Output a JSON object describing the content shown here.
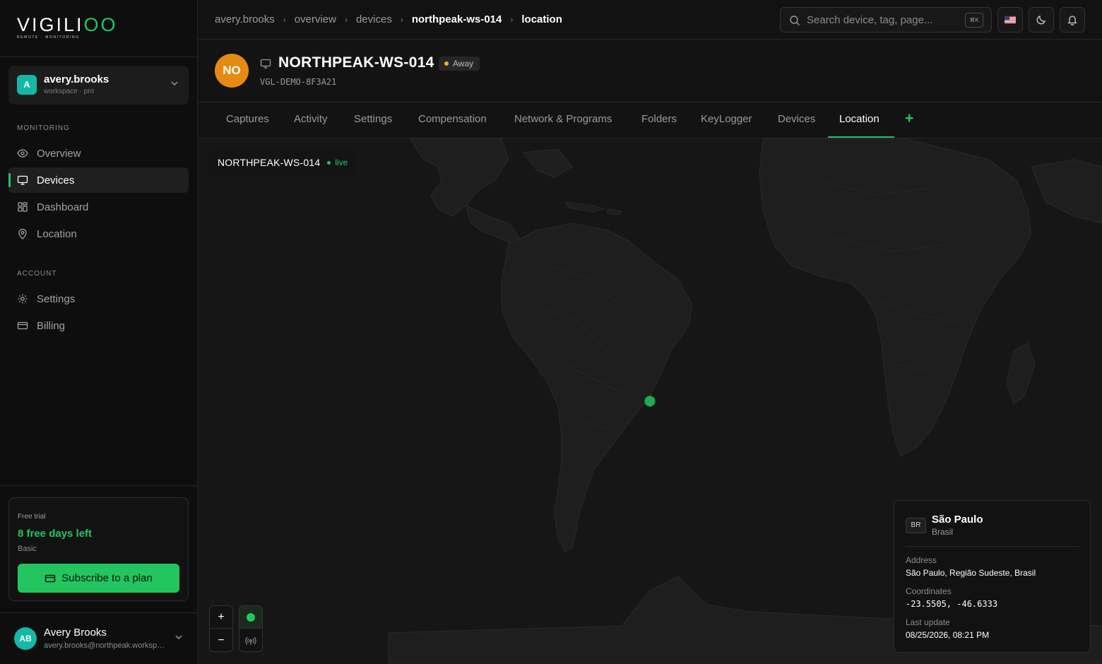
{
  "app": {
    "logo_text": "VIGILI",
    "logo_text_accent": "OO",
    "logo_tagline": "REMOTE · MONITORING",
    "brand_color": "#22c55e"
  },
  "workspace": {
    "avatar_letter": "A",
    "name": "avery.brooks",
    "plan": "workspace · pro"
  },
  "sidebar": {
    "monitoring_label": "MONITORING",
    "monitoring_items": [
      {
        "label": "Overview",
        "icon": "eye-icon",
        "active": false
      },
      {
        "label": "Devices",
        "icon": "monitor-icon",
        "active": true
      },
      {
        "label": "Dashboard",
        "icon": "grid-icon",
        "active": false
      },
      {
        "label": "Location",
        "icon": "map-pin-icon",
        "active": false
      }
    ],
    "account_label": "ACCOUNT",
    "account_items": [
      {
        "label": "Settings",
        "icon": "gear-icon"
      },
      {
        "label": "Billing",
        "icon": "credit-card-icon"
      }
    ]
  },
  "trial": {
    "label": "Free trial",
    "days_left": "8 free days left",
    "plan": "Basic",
    "button": "Subscribe to a plan"
  },
  "user": {
    "initials": "AB",
    "name": "Avery Brooks",
    "email": "avery.brooks@northpeak.workspace"
  },
  "breadcrumbs": [
    "avery.brooks",
    "overview",
    "devices",
    "northpeak-ws-014",
    "location"
  ],
  "search": {
    "placeholder": "Search device, tag, page...",
    "shortcut": "⌘K"
  },
  "device": {
    "initials": "NO",
    "name": "NORTHPEAK-WS-014",
    "status": "Away",
    "status_color": "#f5b32a",
    "id": "VGL-DEMO-8F3A21"
  },
  "tabs": [
    "Captures",
    "Activity",
    "Settings",
    "Compensation",
    "Network & Programs",
    "Folders",
    "KeyLogger",
    "Devices",
    "Location"
  ],
  "active_tab": "Location",
  "map": {
    "chip_name": "NORTHPEAK-WS-014",
    "chip_status": "live"
  },
  "location": {
    "country_code": "BR",
    "city": "São Paulo",
    "country": "Brasil",
    "address_label": "Address",
    "address": "São Paulo, Região Sudeste, Brasil",
    "coordinates_label": "Coordinates",
    "coordinates": "-23.5505, -46.6333",
    "last_update_label": "Last update",
    "last_update": "08/25/2026, 08:21 PM"
  }
}
